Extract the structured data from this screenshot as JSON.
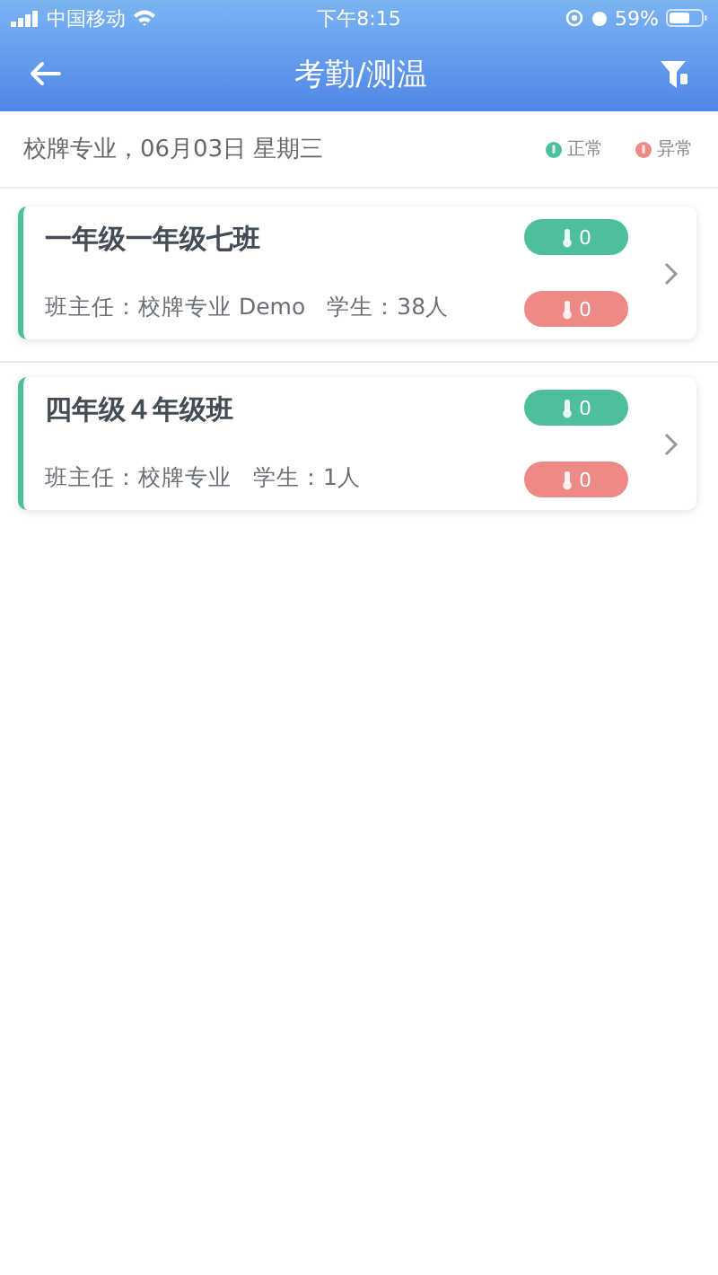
{
  "status_bar": {
    "carrier": "中国移动",
    "time": "下午8:15",
    "battery": "59%"
  },
  "header": {
    "title": "考勤/测温"
  },
  "summary": {
    "text": "校牌专业，06月03日 星期三",
    "legend": [
      {
        "label": "正常",
        "color": "#4dbf9c"
      },
      {
        "label": "异常",
        "color": "#ee8a86"
      }
    ]
  },
  "classes": [
    {
      "name": "一年级一年级七班",
      "teacher": "班主任：校牌专业 Demo",
      "students": "学生：38人",
      "normal_count": "0",
      "abnormal_count": "0"
    },
    {
      "name": "四年级４年级班",
      "teacher": "班主任：校牌专业",
      "students": "学生：1人",
      "normal_count": "0",
      "abnormal_count": "0"
    }
  ]
}
